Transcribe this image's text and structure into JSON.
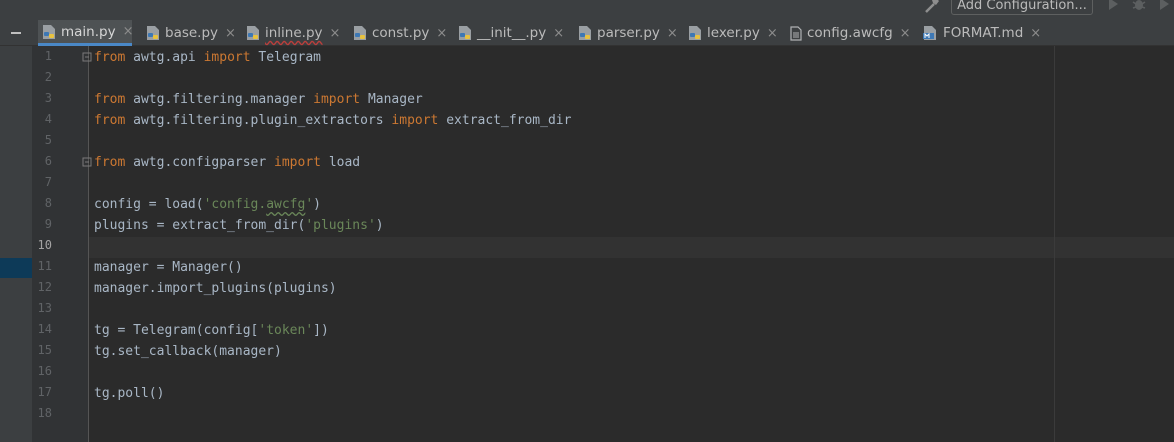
{
  "toolbar": {
    "config_button_label": "Add Configuration..."
  },
  "tabs": [
    {
      "label": "main.py",
      "icon": "python-file-icon",
      "active": true
    },
    {
      "label": "base.py",
      "icon": "python-file-icon"
    },
    {
      "label": "inline.py",
      "icon": "python-file-icon"
    },
    {
      "label": "const.py",
      "icon": "python-file-icon"
    },
    {
      "label": "__init__.py",
      "icon": "python-file-icon"
    },
    {
      "label": "parser.py",
      "icon": "python-file-icon"
    },
    {
      "label": "lexer.py",
      "icon": "python-file-icon"
    },
    {
      "label": "config.awcfg",
      "icon": "text-file-icon"
    },
    {
      "label": "FORMAT.md",
      "icon": "markdown-file-icon"
    }
  ],
  "close_glyph": "×",
  "editor": {
    "current_line": 10,
    "line_numbers": [
      "1",
      "2",
      "3",
      "4",
      "5",
      "6",
      "7",
      "8",
      "9",
      "10",
      "11",
      "12",
      "13",
      "14",
      "15",
      "16",
      "17",
      "18"
    ],
    "code": {
      "l1": {
        "kw1": "from",
        "t1": " awtg.api ",
        "kw2": "import",
        "t2": " Telegram"
      },
      "l3": {
        "kw1": "from",
        "t1": " awtg.filtering.manager ",
        "kw2": "import",
        "t2": " Manager"
      },
      "l4": {
        "kw1": "from",
        "t1": " awtg.filtering.plugin_extractors ",
        "kw2": "import",
        "t2": " extract_from_dir"
      },
      "l6": {
        "kw1": "from",
        "t1": " awtg.configparser ",
        "kw2": "import",
        "t2": " load"
      },
      "l8": {
        "t1": "config = load(",
        "s1": "'config.",
        "s2": "awcfg",
        "s3": "'",
        "t2": ")"
      },
      "l9": {
        "t1": "plugins = extract_from_dir(",
        "s1": "'plugins'",
        "t2": ")"
      },
      "l11": {
        "t1": "manager = Manager()"
      },
      "l12": {
        "t1": "manager.import_plugins(plugins)"
      },
      "l14": {
        "t1": "tg = Telegram(config[",
        "s1": "'token'",
        "t2": "])"
      },
      "l15": {
        "t1": "tg.set_callback(manager)"
      },
      "l17": {
        "t1": "tg.poll()"
      }
    }
  },
  "colors": {
    "background": "#2b2b2b",
    "keyword": "#cc7832",
    "string": "#6a8759",
    "text": "#a9b7c6",
    "active_tab_underline": "#4a88c7"
  }
}
